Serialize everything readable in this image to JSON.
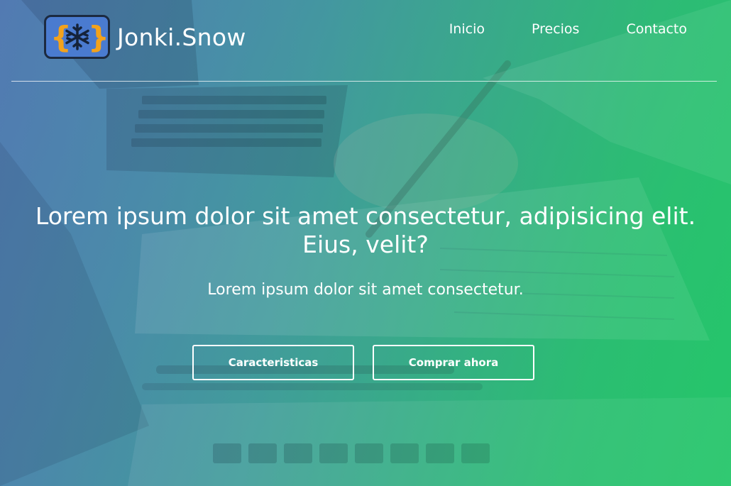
{
  "brand": {
    "name": "Jonki.Snow",
    "logo_icon": "snowflake-braces-logo",
    "logo_color": "#4a7bd0",
    "brace_color": "#f3a21c"
  },
  "nav": {
    "items": [
      {
        "label": "Inicio"
      },
      {
        "label": "Precios"
      },
      {
        "label": "Contacto"
      }
    ]
  },
  "hero": {
    "headline": "Lorem ipsum dolor sit amet consectetur, adipisicing elit. Eius, velit?",
    "subheadline": "Lorem ipsum dolor sit amet consectetur.",
    "buttons": {
      "features_label": "Caracteristicas",
      "buy_label": "Comprar ahora"
    }
  },
  "colors": {
    "gradient_start": "#4f7fb0",
    "gradient_end": "#27c36a",
    "text": "#ffffff"
  }
}
